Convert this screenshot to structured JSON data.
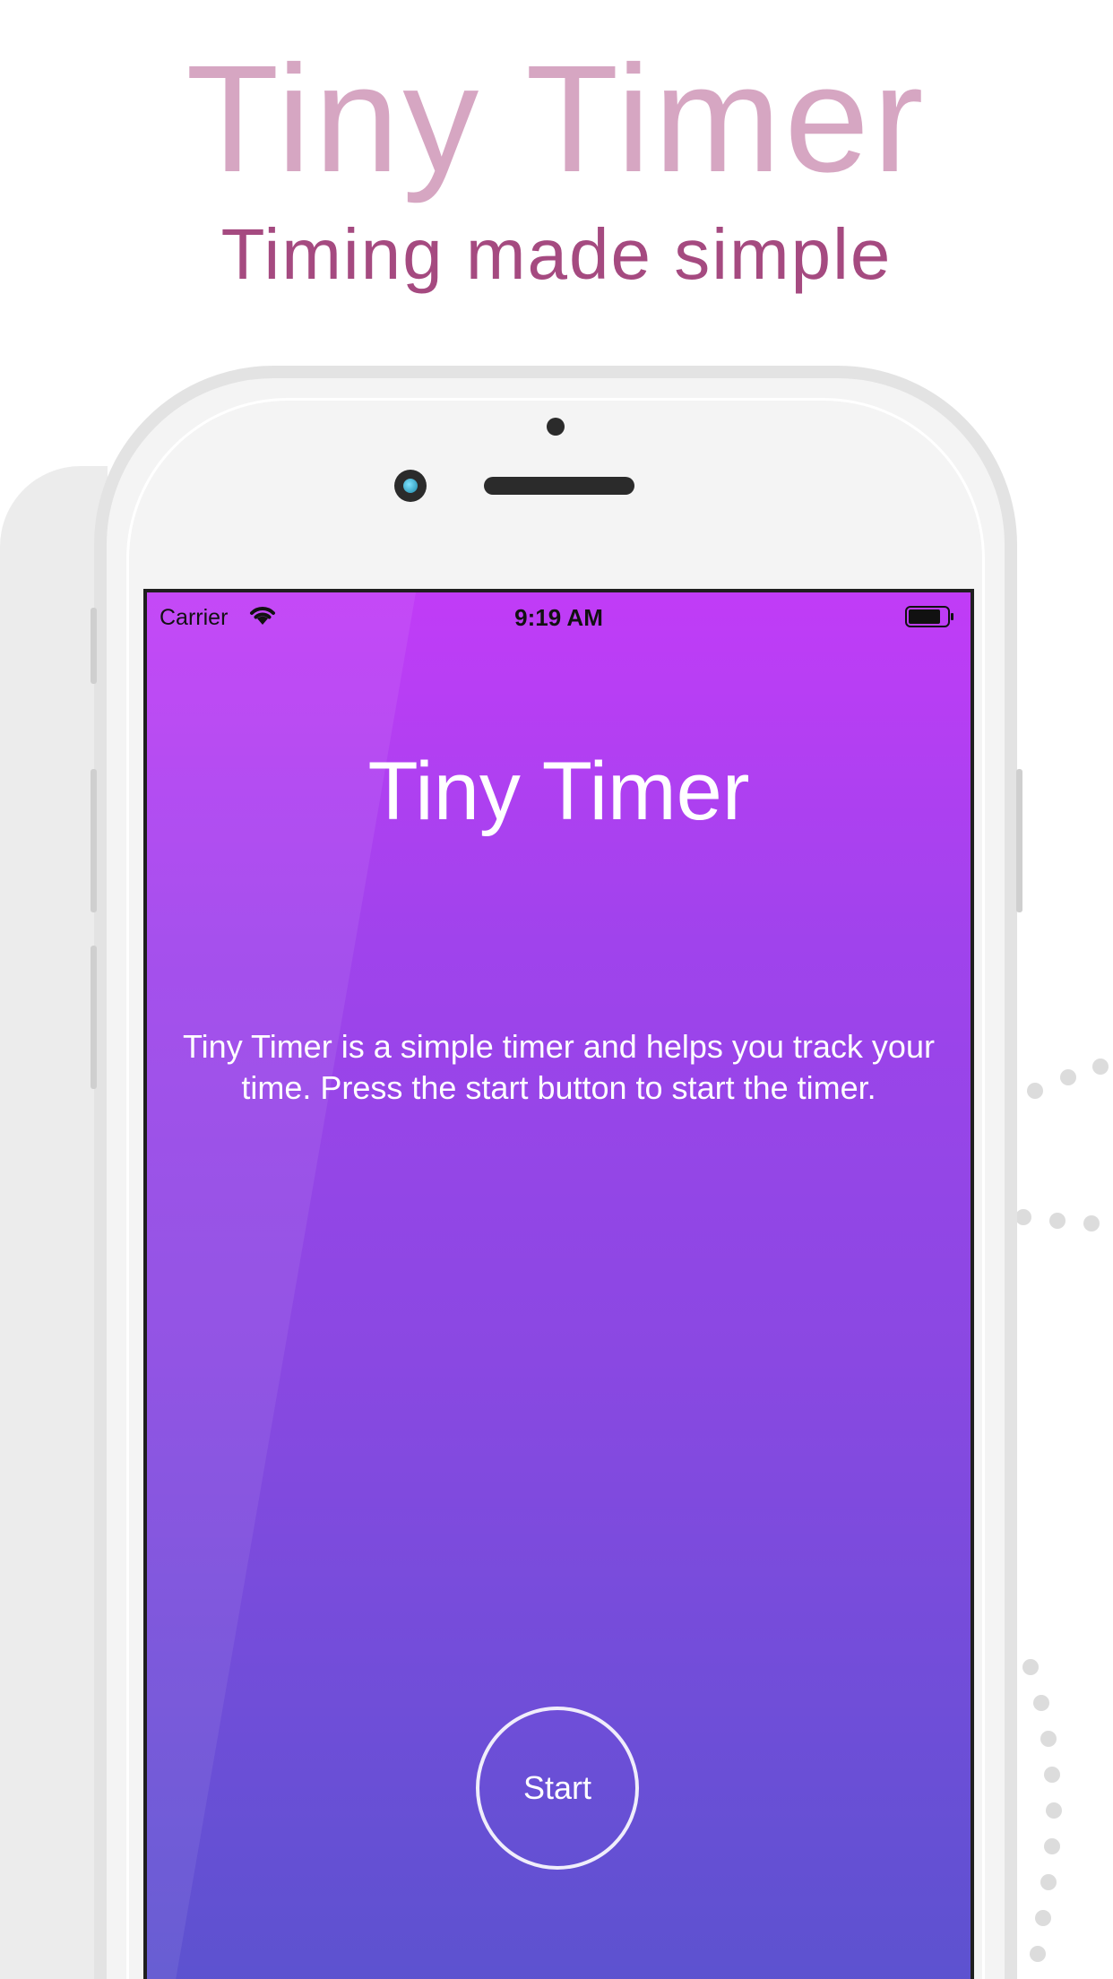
{
  "promo": {
    "title": "Tiny Timer",
    "subtitle": "Timing made simple"
  },
  "status_bar": {
    "carrier": "Carrier",
    "time": "9:19 AM",
    "wifi_icon": "wifi-icon",
    "battery_icon": "battery-icon"
  },
  "app": {
    "title": "Tiny Timer",
    "description": "Tiny Timer is a simple timer and helps you track your time. Press the start button to start the timer.",
    "start_label": "Start"
  },
  "colors": {
    "promo_title": "#d6a6c2",
    "promo_subtitle": "#a54a80",
    "gradient_top": "#c13cf7",
    "gradient_bottom": "#5c52cf"
  }
}
